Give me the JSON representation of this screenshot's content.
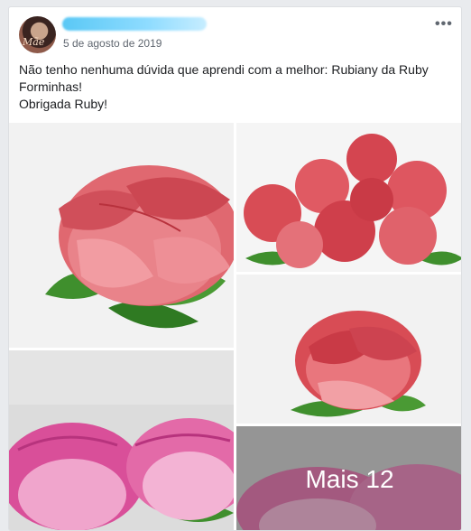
{
  "post": {
    "avatar_text": "Mãe",
    "date": "5 de agosto de 2019",
    "more_icon": "more-horizontal-icon",
    "text_lines": [
      "Não tenho nenhuma dúvida que aprendi com a melhor: Rubiany da Ruby",
      "Forminhas!",
      "Obrigada Ruby!"
    ],
    "more_photos_label": "Mais 12"
  },
  "colors": {
    "rose_red": "#d84c55",
    "rose_pink": "#e36aa8",
    "leaf_green": "#3f8f2d"
  }
}
